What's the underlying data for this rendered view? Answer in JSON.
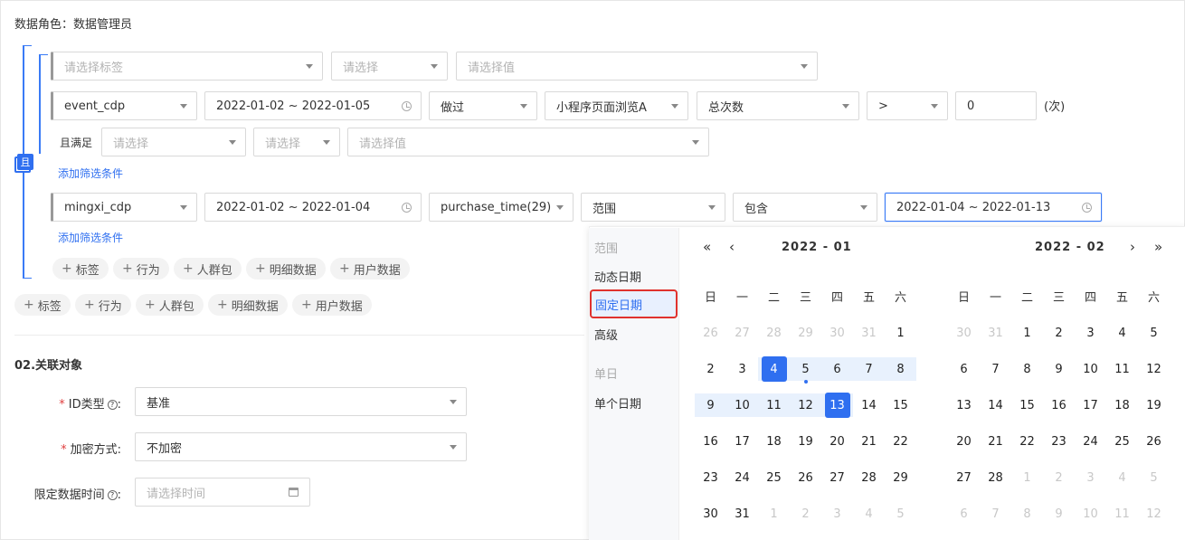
{
  "title": "数据角色：数据管理员",
  "rows": {
    "row1": {
      "tag": "请选择标签",
      "op": "请选择",
      "value": "请选择值"
    },
    "row2": {
      "source": "event_cdp",
      "date": "2022-01-02 ~ 2022-01-05",
      "action": "做过",
      "event": "小程序页面浏览A",
      "metric": "总次数",
      "compare": ">",
      "number": "0",
      "unit": "(次)"
    },
    "row3": {
      "label": "且满足",
      "field": "请选择",
      "op": "请选择",
      "value": "请选择值"
    },
    "add_filter_1": "添加筛选条件",
    "row4": {
      "source": "mingxi_cdp",
      "date": "2022-01-02 ~ 2022-01-04",
      "field": "purchase_time(29)",
      "mode": "范围",
      "op": "包含",
      "range": "2022-01-04 ~ 2022-01-13"
    },
    "add_filter_2": "添加筛选条件"
  },
  "and_badge": "且",
  "inner_pills": [
    "标签",
    "行为",
    "人群包",
    "明细数据",
    "用户数据"
  ],
  "outer_pills": [
    "标签",
    "行为",
    "人群包",
    "明细数据",
    "用户数据"
  ],
  "section2": {
    "title": "02.关联对象",
    "id_type_label": "ID类型",
    "id_type_value": "基准",
    "encrypt_label": "加密方式",
    "encrypt_value": "不加密",
    "time_label": "限定数据时间",
    "time_placeholder": "请选择时间"
  },
  "picker": {
    "sidebar": {
      "group1": "范围",
      "dynamic": "动态日期",
      "fixed": "固定日期",
      "advanced": "高级",
      "group2": "单日",
      "single": "单个日期"
    },
    "left_month": "2022 - 01",
    "right_month": "2022 - 02",
    "weekdays": [
      "日",
      "一",
      "二",
      "三",
      "四",
      "五",
      "六"
    ],
    "nav": {
      "prev_year": "«",
      "prev_month": "‹",
      "next_month": "›",
      "next_year": "»"
    },
    "left_days": [
      [
        "26",
        "27",
        "28",
        "29",
        "30",
        "31",
        "1"
      ],
      [
        "2",
        "3",
        "4",
        "5",
        "6",
        "7",
        "8"
      ],
      [
        "9",
        "10",
        "11",
        "12",
        "13",
        "14",
        "15"
      ],
      [
        "16",
        "17",
        "18",
        "19",
        "20",
        "21",
        "22"
      ],
      [
        "23",
        "24",
        "25",
        "26",
        "27",
        "28",
        "29"
      ],
      [
        "30",
        "31",
        "1",
        "2",
        "3",
        "4",
        "5"
      ]
    ],
    "right_days": [
      [
        "30",
        "31",
        "1",
        "2",
        "3",
        "4",
        "5"
      ],
      [
        "6",
        "7",
        "8",
        "9",
        "10",
        "11",
        "12"
      ],
      [
        "13",
        "14",
        "15",
        "16",
        "17",
        "18",
        "19"
      ],
      [
        "20",
        "21",
        "22",
        "23",
        "24",
        "25",
        "26"
      ],
      [
        "27",
        "28",
        "1",
        "2",
        "3",
        "4",
        "5"
      ],
      [
        "6",
        "7",
        "8",
        "9",
        "10",
        "11",
        "12"
      ]
    ],
    "accent": "#2f6ff0"
  }
}
